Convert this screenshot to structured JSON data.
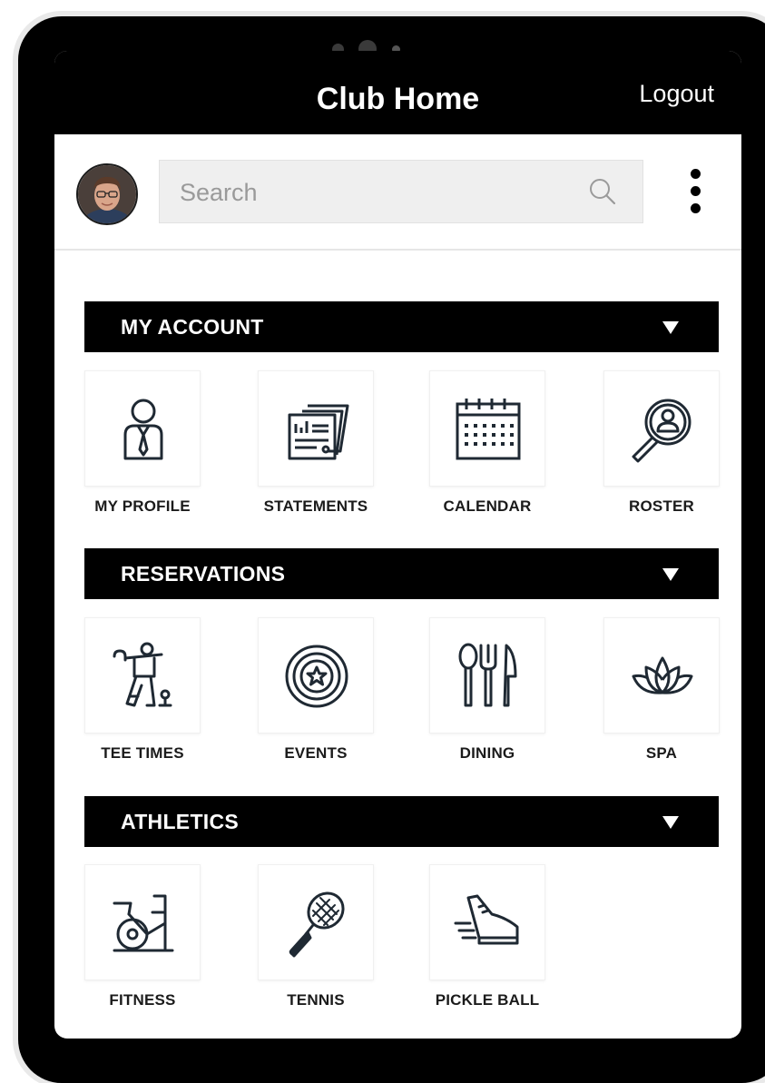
{
  "header": {
    "title": "Club Home",
    "logout_label": "Logout"
  },
  "search": {
    "placeholder": "Search",
    "value": ""
  },
  "sections": [
    {
      "label": "MY ACCOUNT",
      "items": [
        {
          "label": "MY PROFILE",
          "icon": "profile-icon"
        },
        {
          "label": "STATEMENTS",
          "icon": "statements-icon"
        },
        {
          "label": "CALENDAR",
          "icon": "calendar-icon"
        },
        {
          "label": "ROSTER",
          "icon": "roster-icon"
        }
      ]
    },
    {
      "label": "RESERVATIONS",
      "items": [
        {
          "label": "TEE TIMES",
          "icon": "golfer-icon"
        },
        {
          "label": "EVENTS",
          "icon": "events-star-icon"
        },
        {
          "label": "DINING",
          "icon": "dining-utensils-icon"
        },
        {
          "label": "SPA",
          "icon": "lotus-icon"
        }
      ]
    },
    {
      "label": "ATHLETICS",
      "items": [
        {
          "label": "FITNESS",
          "icon": "exercise-bike-icon"
        },
        {
          "label": "TENNIS",
          "icon": "tennis-racket-icon"
        },
        {
          "label": "PICKLE BALL",
          "icon": "sneaker-icon"
        }
      ]
    }
  ],
  "colors": {
    "bar": "#000000",
    "icon_stroke": "#1f2933",
    "search_bg": "#efefef"
  }
}
